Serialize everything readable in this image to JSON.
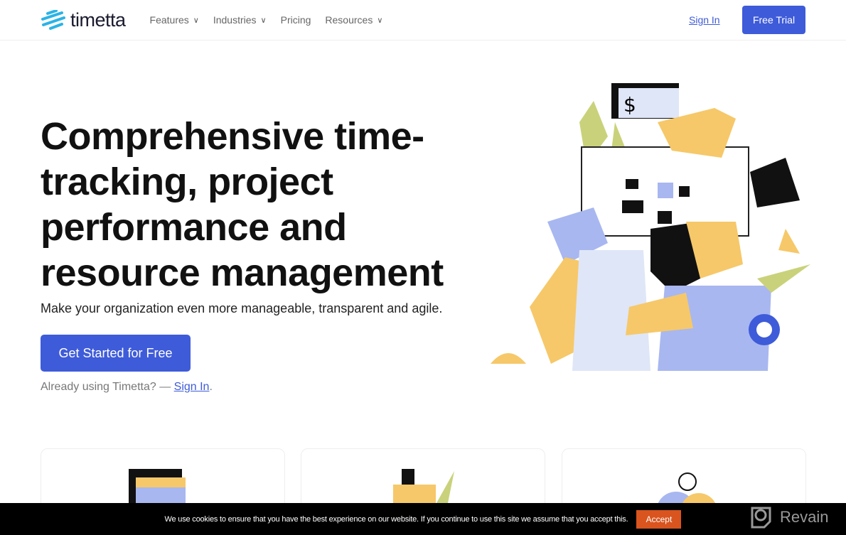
{
  "nav": {
    "brand": "timetta",
    "items": [
      {
        "label": "Features",
        "dropdown": true
      },
      {
        "label": "Industries",
        "dropdown": true
      },
      {
        "label": "Pricing",
        "dropdown": false
      },
      {
        "label": "Resources",
        "dropdown": true
      }
    ],
    "sign_in": "Sign In",
    "free_trial": "Free Trial"
  },
  "hero": {
    "title": "Comprehensive time-tracking, project performance and resource management",
    "subtitle": "Make your organization even more manageable, transparent and agile.",
    "cta": "Get Started for Free",
    "already_prefix": "Already using Timetta? — ",
    "already_link": "Sign In",
    "already_suffix": "."
  },
  "cookie": {
    "text": "We use cookies to ensure that you have the best experience on our website. If you continue to use this site we assume that you accept this.",
    "accept": "Accept"
  },
  "watermark": "Revain",
  "colors": {
    "accent": "#3e5bd9",
    "cookie_button": "#d9541e",
    "logo": "#2bb3e6"
  }
}
